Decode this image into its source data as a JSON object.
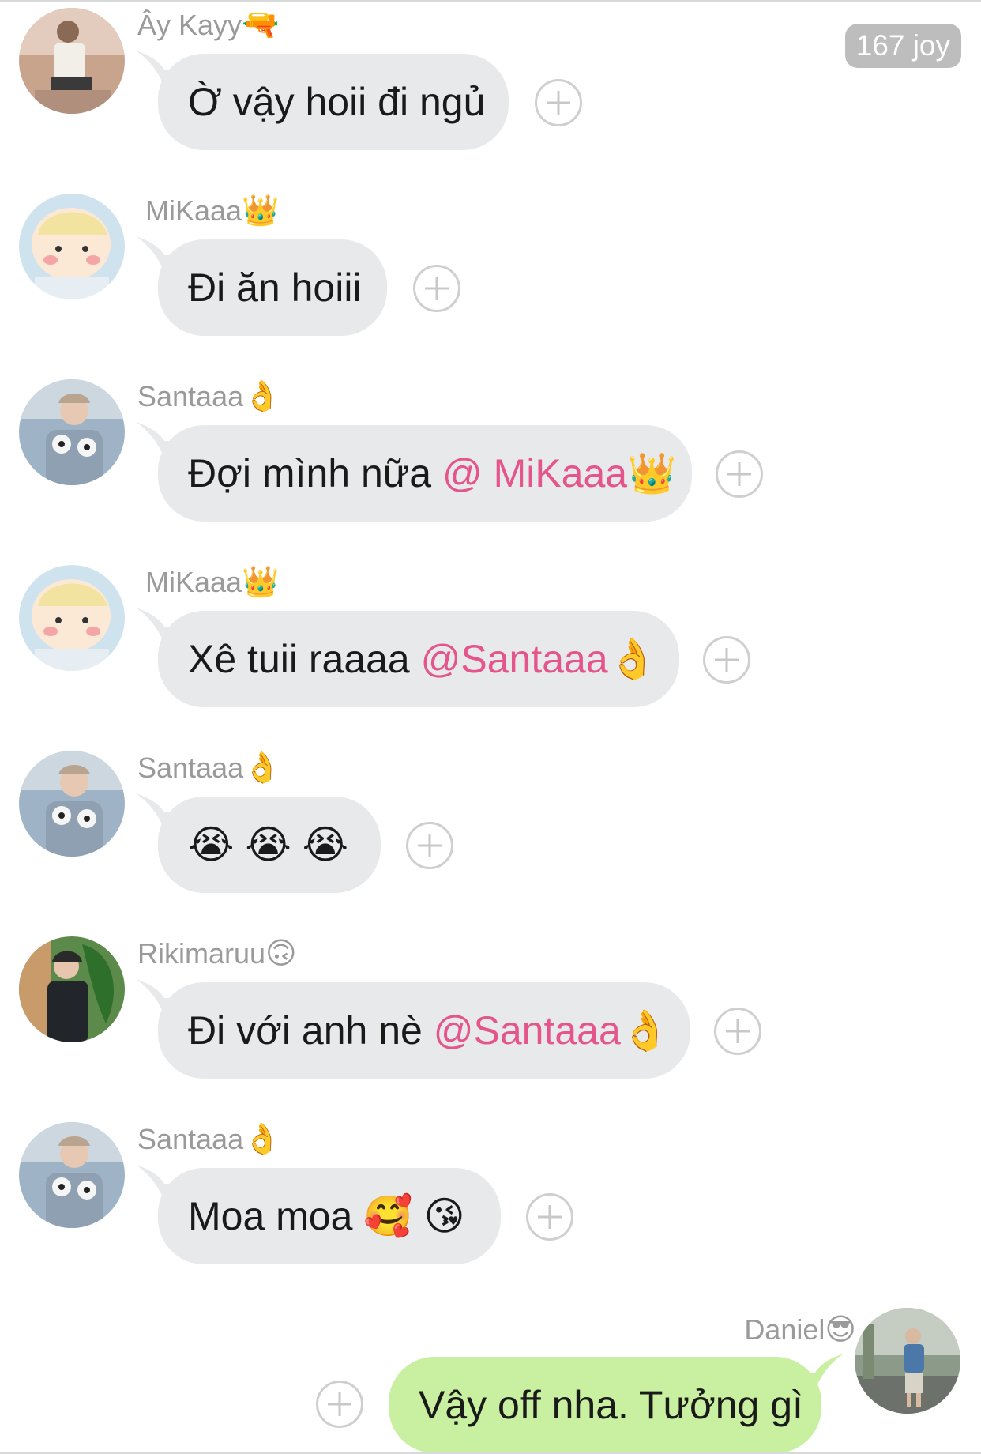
{
  "counter": "167 joy",
  "messages": [
    {
      "sender_name": "Ây Kayy",
      "sender_emoji": "🔫",
      "text": "Ờ vậy hoii đi ngủ",
      "mention": "",
      "tail_emoji": ""
    },
    {
      "sender_name": "MiKaaa",
      "sender_emoji": "👑",
      "text": "Đi ăn hoiii",
      "mention": "",
      "tail_emoji": ""
    },
    {
      "sender_name": "Santaaa",
      "sender_emoji": "👌",
      "text": "Đợi mình nữa ",
      "mention": "@ MiKaaa",
      "tail_emoji": "👑"
    },
    {
      "sender_name": "MiKaaa",
      "sender_emoji": "👑",
      "text": "Xê tuii raaaa ",
      "mention": "@Santaaa",
      "tail_emoji": "👌"
    },
    {
      "sender_name": "Santaaa",
      "sender_emoji": "👌",
      "text": "😭 😭 😭",
      "mention": "",
      "tail_emoji": ""
    },
    {
      "sender_name": "Rikimaruu",
      "sender_emoji": "🙃",
      "text": "Đi với anh nè ",
      "mention": "@Santaaa",
      "tail_emoji": "👌"
    },
    {
      "sender_name": "Santaaa",
      "sender_emoji": "👌",
      "text": "Moa moa 🥰 😘",
      "mention": "",
      "tail_emoji": ""
    }
  ],
  "outgoing": {
    "sender_name": "Daniel",
    "sender_emoji": "😎",
    "text": "Vậy off nha. Tưởng gì"
  },
  "colors": {
    "incoming_bubble": "#e8e9eb",
    "outgoing_bubble": "#c9f0a0",
    "mention": "#e4558b",
    "sender_name": "#9a9a9a"
  }
}
